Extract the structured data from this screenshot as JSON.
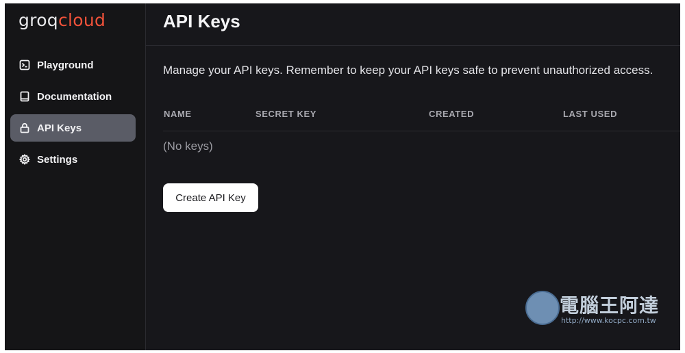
{
  "brand": {
    "part1": "groq",
    "part2": "cloud"
  },
  "sidebar": {
    "items": [
      {
        "label": "Playground",
        "icon": "terminal-icon",
        "active": false
      },
      {
        "label": "Documentation",
        "icon": "book-icon",
        "active": false
      },
      {
        "label": "API Keys",
        "icon": "lock-icon",
        "active": true
      },
      {
        "label": "Settings",
        "icon": "gear-icon",
        "active": false
      }
    ]
  },
  "page": {
    "title": "API Keys",
    "description": "Manage your API keys. Remember to keep your API keys safe to prevent unauthorized access."
  },
  "table": {
    "columns": [
      "NAME",
      "SECRET KEY",
      "CREATED",
      "LAST USED"
    ],
    "empty_text": "(No keys)"
  },
  "actions": {
    "create_label": "Create API Key"
  },
  "watermark": {
    "text": "電腦王阿達",
    "url": "http://www.kocpc.com.tw"
  },
  "colors": {
    "accent": "#f0523a",
    "active_nav": "#5a5c66",
    "background": "#17171b"
  }
}
